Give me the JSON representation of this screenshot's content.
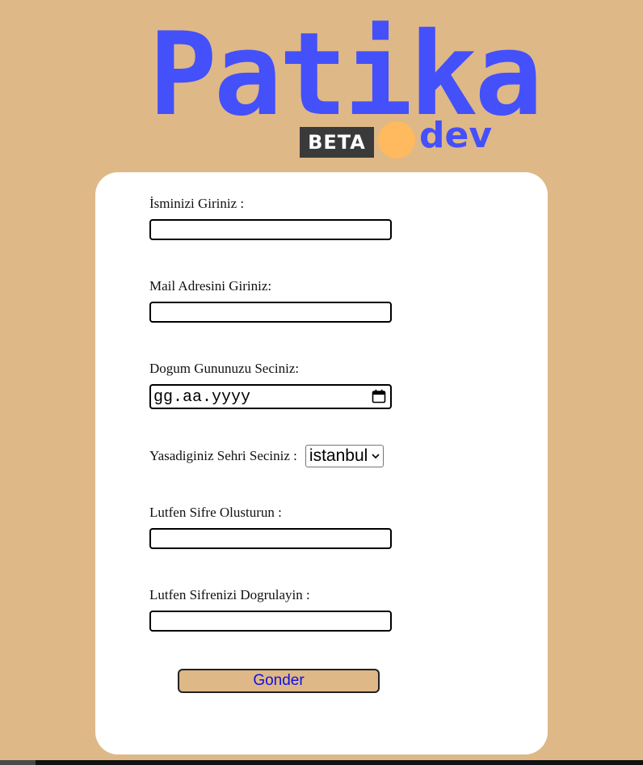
{
  "logo": {
    "wordmark": "Patika",
    "badge": "BETA",
    "suffix": "dev",
    "wordmark_color": "#4450FA",
    "badge_color": "#3A3A3A",
    "dot_color": "#FFB95E"
  },
  "colors": {
    "page_background": "#DFB887",
    "card_background": "#FFFFFF",
    "button_text": "#1010E0"
  },
  "form": {
    "name_label": "İsminizi Giriniz :",
    "name_value": "",
    "email_label": "Mail Adresini Giriniz:",
    "email_value": "",
    "birthday_label": "Dogum Gununuzu Seciniz:",
    "birthday_placeholder": "gg.aa.yyyy",
    "city_label": "Yasadiginiz Sehri Seciniz :",
    "city_selected": "istanbul",
    "password_label": "Lutfen Sifre Olusturun :",
    "password_value": "",
    "password_confirm_label": "Lutfen Sifrenizi Dogrulayin :",
    "password_confirm_value": "",
    "submit_label": "Gonder"
  }
}
